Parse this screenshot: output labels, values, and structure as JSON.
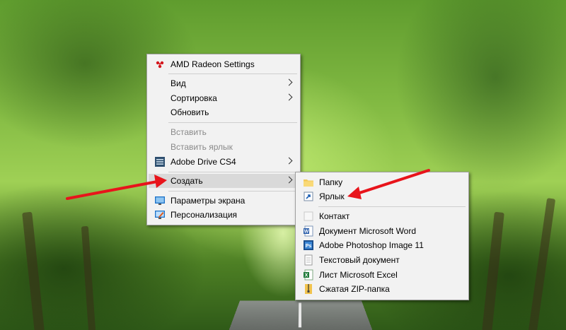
{
  "context_menu": {
    "items": [
      {
        "label": "AMD Radeon Settings",
        "icon": "amd-radeon-icon",
        "enabled": true
      },
      {
        "label": "Вид",
        "submenu": true,
        "enabled": true
      },
      {
        "label": "Сортировка",
        "submenu": true,
        "enabled": true
      },
      {
        "label": "Обновить",
        "enabled": true
      },
      {
        "label": "Вставить",
        "enabled": false
      },
      {
        "label": "Вставить ярлык",
        "enabled": false
      },
      {
        "label": "Adobe Drive CS4",
        "icon": "adobe-drive-icon",
        "submenu": true,
        "enabled": true
      },
      {
        "label": "Создать",
        "submenu": true,
        "highlighted": true,
        "enabled": true
      },
      {
        "label": "Параметры экрана",
        "icon": "display-settings-icon",
        "enabled": true
      },
      {
        "label": "Персонализация",
        "icon": "personalization-icon",
        "enabled": true
      }
    ]
  },
  "new_submenu": {
    "items": [
      {
        "label": "Папку",
        "icon": "folder-icon"
      },
      {
        "label": "Ярлык",
        "icon": "shortcut-icon"
      },
      {
        "label": "Контакт",
        "icon": "contact-icon"
      },
      {
        "label": "Документ Microsoft Word",
        "icon": "word-document-icon"
      },
      {
        "label": "Adobe Photoshop Image 11",
        "icon": "photoshop-image-icon"
      },
      {
        "label": "Текстовый документ",
        "icon": "text-document-icon"
      },
      {
        "label": "Лист Microsoft Excel",
        "icon": "excel-sheet-icon"
      },
      {
        "label": "Сжатая ZIP-папка",
        "icon": "zip-folder-icon"
      }
    ]
  },
  "colors": {
    "menu_background": "#f2f2f2",
    "highlight": "#d9d9d9",
    "disabled_text": "#8a8a8a",
    "annotation_arrow": "#e8141b"
  }
}
